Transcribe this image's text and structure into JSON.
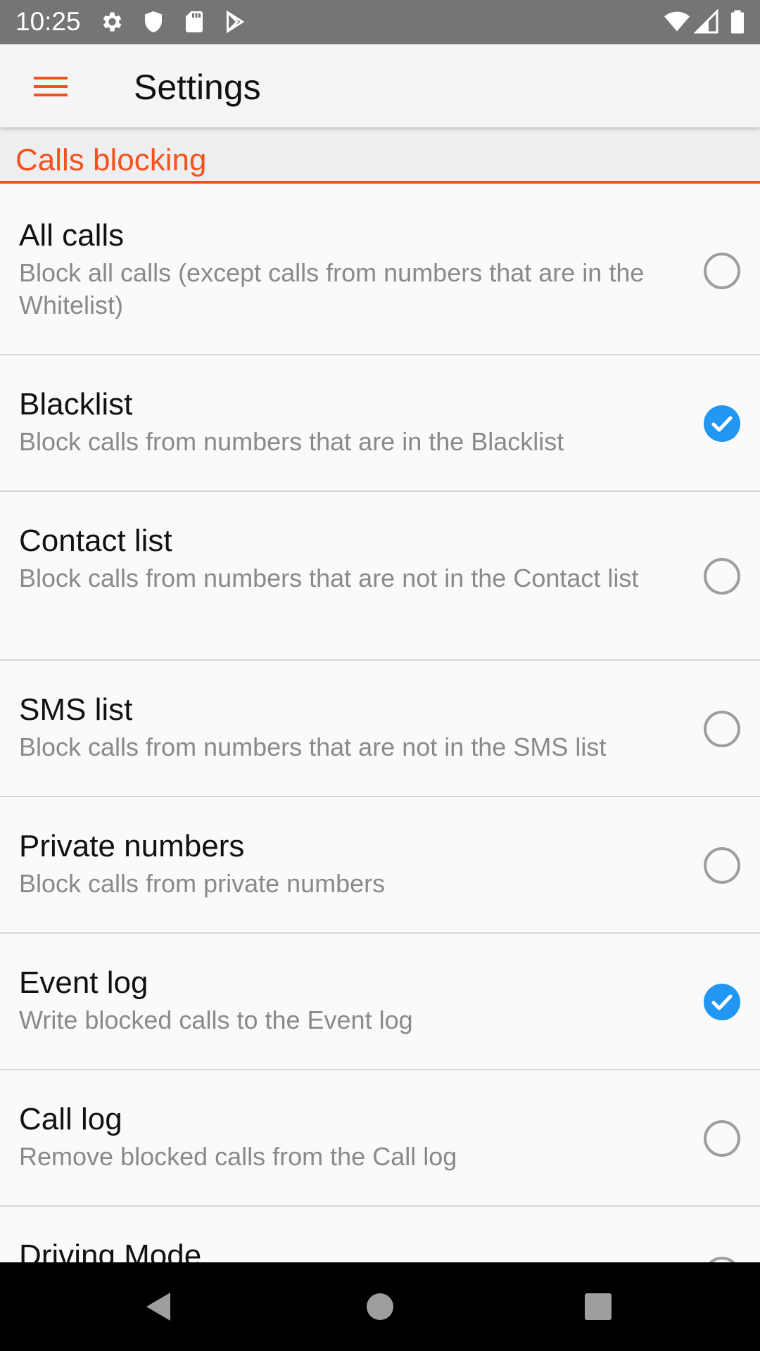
{
  "status_bar": {
    "time": "10:25",
    "left_icons": [
      "gear-icon",
      "shield-icon",
      "sd-card-icon",
      "play-store-icon"
    ],
    "right_icons": [
      "wifi-icon",
      "cell-signal-icon",
      "battery-icon"
    ]
  },
  "toolbar": {
    "title": "Settings",
    "menu_icon": "hamburger-menu-icon",
    "accent_color": "#f4511e"
  },
  "category": {
    "label": "Calls blocking"
  },
  "preferences": [
    {
      "title": "All calls",
      "summary": "Block all calls (except calls from numbers that are in the Whitelist)",
      "checked": false
    },
    {
      "title": "Blacklist",
      "summary": "Block calls from numbers that are in the Blacklist",
      "checked": true
    },
    {
      "title": "Contact list",
      "summary": "Block calls from numbers that are not in the Contact list",
      "checked": false
    },
    {
      "title": "SMS list",
      "summary": "Block calls from numbers that are not in the SMS list",
      "checked": false
    },
    {
      "title": "Private numbers",
      "summary": "Block calls from private numbers",
      "checked": false
    },
    {
      "title": "Event log",
      "summary": "Write blocked calls to the Event log",
      "checked": true
    },
    {
      "title": "Call log",
      "summary": "Remove blocked calls from the Call log",
      "checked": false
    },
    {
      "title": "Driving Mode",
      "summary": "",
      "checked": false
    }
  ],
  "colors": {
    "checked": "#2196f3",
    "unchecked": "#9e9e9e"
  },
  "nav_bar": {
    "buttons": [
      "back-icon",
      "home-icon",
      "recents-icon"
    ]
  }
}
